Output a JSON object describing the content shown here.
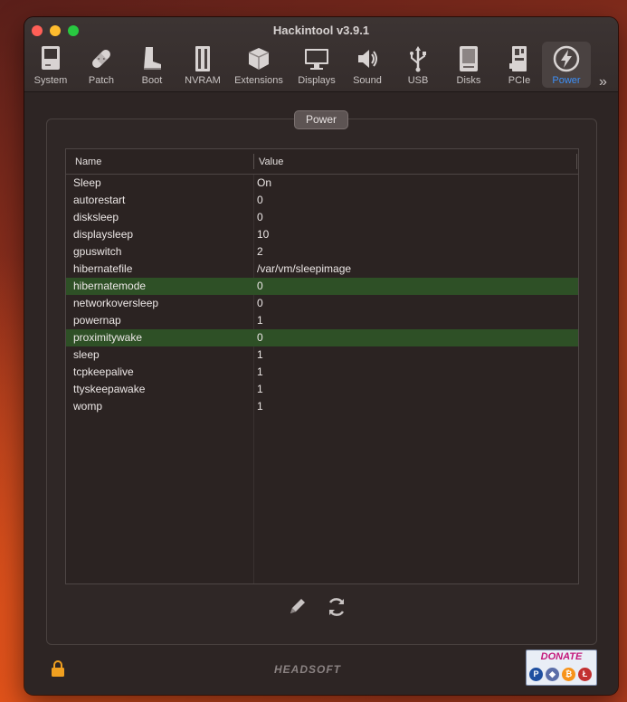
{
  "window": {
    "title": "Hackintool v3.9.1"
  },
  "toolbar": {
    "items": [
      {
        "label": "System",
        "icon": "system-icon"
      },
      {
        "label": "Patch",
        "icon": "patch-icon"
      },
      {
        "label": "Boot",
        "icon": "boot-icon"
      },
      {
        "label": "NVRAM",
        "icon": "nvram-icon"
      },
      {
        "label": "Extensions",
        "icon": "extensions-icon"
      },
      {
        "label": "Displays",
        "icon": "displays-icon"
      },
      {
        "label": "Sound",
        "icon": "sound-icon"
      },
      {
        "label": "USB",
        "icon": "usb-icon"
      },
      {
        "label": "Disks",
        "icon": "disks-icon"
      },
      {
        "label": "PCIe",
        "icon": "pcie-icon"
      },
      {
        "label": "Power",
        "icon": "power-icon",
        "active": true
      }
    ],
    "more": "»"
  },
  "panel": {
    "title": "Power"
  },
  "table": {
    "headers": {
      "name": "Name",
      "value": "Value"
    },
    "rows": [
      {
        "name": "Sleep",
        "value": "On"
      },
      {
        "name": "autorestart",
        "value": "0"
      },
      {
        "name": "disksleep",
        "value": "0"
      },
      {
        "name": "displaysleep",
        "value": "10"
      },
      {
        "name": "gpuswitch",
        "value": "2"
      },
      {
        "name": "hibernatefile",
        "value": "/var/vm/sleepimage"
      },
      {
        "name": "hibernatemode",
        "value": "0",
        "highlighted": true
      },
      {
        "name": "networkoversleep",
        "value": "0"
      },
      {
        "name": "powernap",
        "value": "1"
      },
      {
        "name": "proximitywake",
        "value": "0",
        "highlighted": true
      },
      {
        "name": "sleep",
        "value": "1"
      },
      {
        "name": "tcpkeepalive",
        "value": "1"
      },
      {
        "name": "ttyskeepawake",
        "value": "1"
      },
      {
        "name": "womp",
        "value": "1"
      }
    ]
  },
  "footer": {
    "brand": "HEADSOFT",
    "donate": "DONATE"
  },
  "colors": {
    "accent": "#3d8ef5",
    "highlight_row": "#2e5026",
    "window_bg": "#2d2524"
  }
}
